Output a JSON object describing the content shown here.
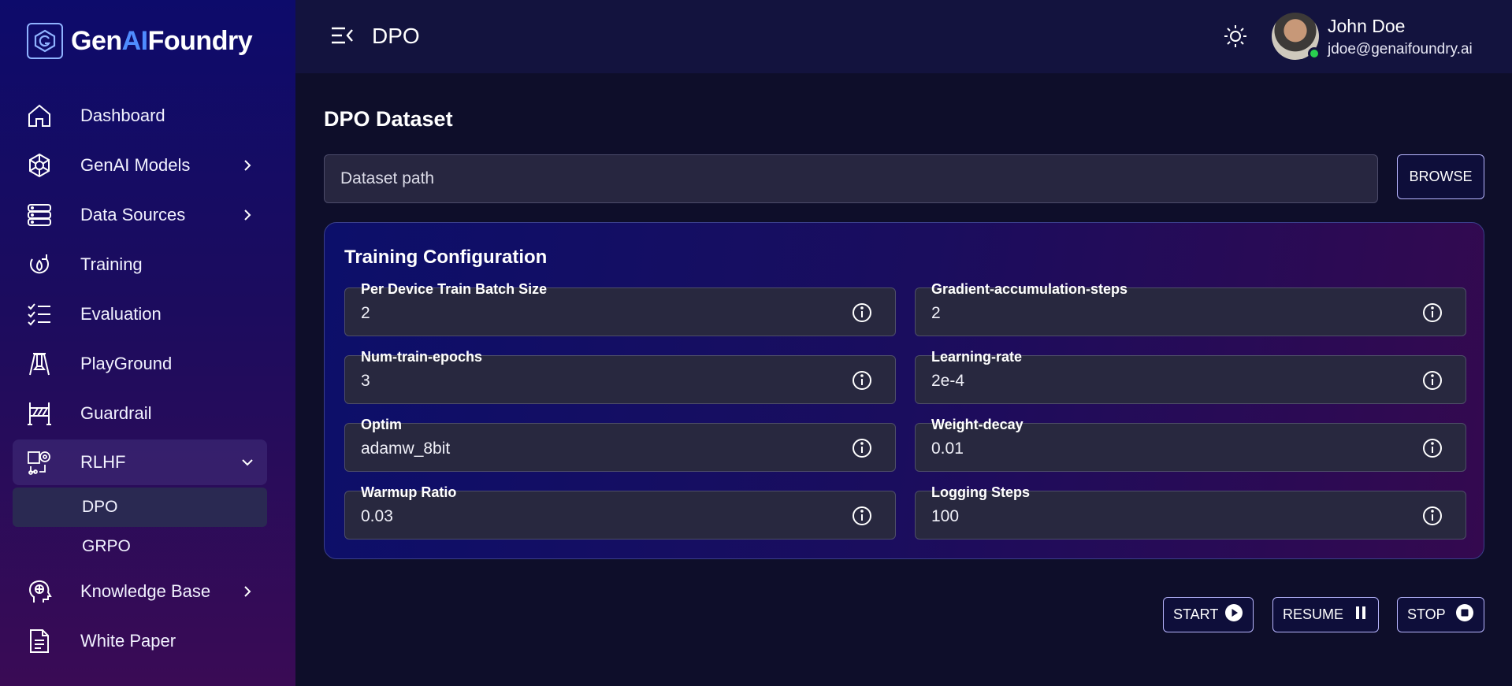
{
  "brand": {
    "prefix": "Gen",
    "accent": "AI",
    "suffix": "Foundry"
  },
  "sidebar": {
    "items": [
      {
        "label": "Dashboard",
        "icon": "home-icon",
        "has_chevron": false
      },
      {
        "label": "GenAI Models",
        "icon": "network-icon",
        "has_chevron": true
      },
      {
        "label": "Data Sources",
        "icon": "database-icon",
        "has_chevron": true
      },
      {
        "label": "Training",
        "icon": "training-icon",
        "has_chevron": false
      },
      {
        "label": "Evaluation",
        "icon": "checklist-icon",
        "has_chevron": false
      },
      {
        "label": "PlayGround",
        "icon": "playground-icon",
        "has_chevron": false
      },
      {
        "label": "Guardrail",
        "icon": "barrier-icon",
        "has_chevron": false
      },
      {
        "label": "RLHF",
        "icon": "rlhf-icon",
        "has_chevron": true,
        "expanded": true,
        "children": [
          {
            "label": "DPO",
            "active": true
          },
          {
            "label": "GRPO",
            "active": false
          }
        ]
      },
      {
        "label": "Knowledge Base",
        "icon": "brain-head-icon",
        "has_chevron": true
      },
      {
        "label": "White Paper",
        "icon": "document-icon",
        "has_chevron": false
      }
    ]
  },
  "header": {
    "title": "DPO",
    "user": {
      "name": "John Doe",
      "email": "jdoe@genaifoundry.ai",
      "status": "online"
    }
  },
  "main": {
    "dataset_title": "DPO Dataset",
    "dataset_placeholder": "Dataset path",
    "dataset_value": "",
    "browse_label": "BROWSE",
    "config": {
      "title": "Training Configuration",
      "fields": [
        {
          "label": "Per Device Train Batch Size",
          "value": "2"
        },
        {
          "label": "Gradient-accumulation-steps",
          "value": "2"
        },
        {
          "label": "Num-train-epochs",
          "value": "3"
        },
        {
          "label": "Learning-rate",
          "value": "2e-4"
        },
        {
          "label": "Optim",
          "value": "adamw_8bit"
        },
        {
          "label": "Weight-decay",
          "value": "0.01"
        },
        {
          "label": "Warmup Ratio",
          "value": "0.03"
        },
        {
          "label": "Logging Steps",
          "value": "100"
        }
      ]
    },
    "actions": {
      "start": "START",
      "resume": "RESUME",
      "stop": "STOP"
    }
  },
  "colors": {
    "accent": "#4f8cff",
    "status_online": "#29d04f",
    "button_border": "#b8b6ff"
  }
}
